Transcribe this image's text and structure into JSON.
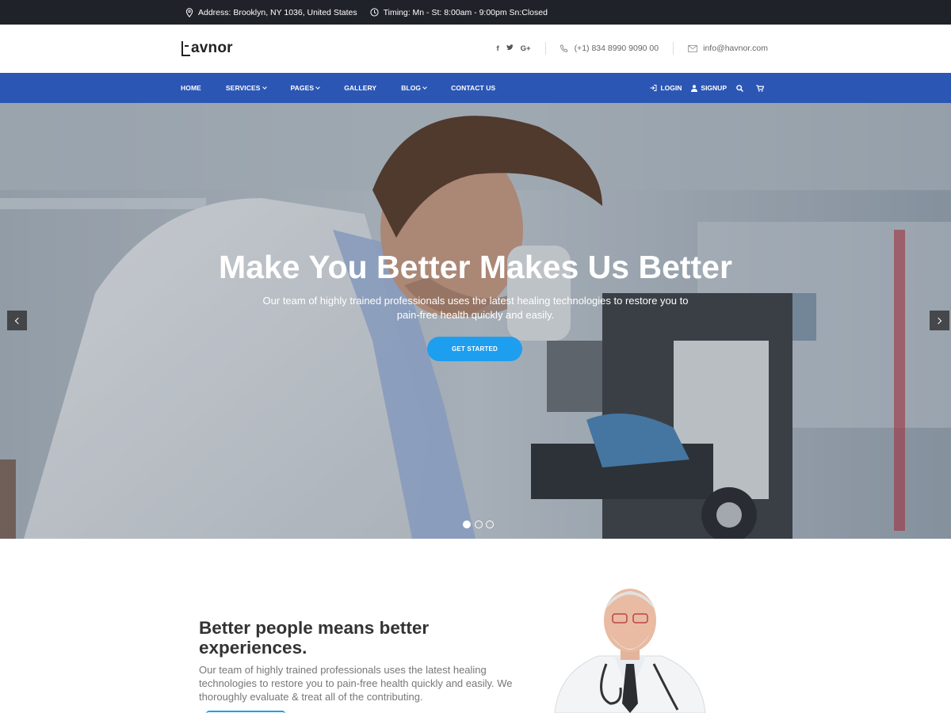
{
  "topbar": {
    "address": "Address: Brooklyn, NY 1036, United States",
    "timing": "Timing: Mn - St: 8:00am - 9:00pm Sn:Closed"
  },
  "header": {
    "logo_text": "avnor",
    "social": [
      "f",
      "y",
      "G+"
    ],
    "phone": "(+1) 834 8990 9090 00",
    "email": "info@havnor.com"
  },
  "nav": {
    "items": [
      {
        "label": "HOME",
        "dropdown": false
      },
      {
        "label": "SERVICES",
        "dropdown": true
      },
      {
        "label": "PAGES",
        "dropdown": true
      },
      {
        "label": "GALLERY",
        "dropdown": false
      },
      {
        "label": "BLOG",
        "dropdown": true
      },
      {
        "label": "CONTACT US",
        "dropdown": false
      }
    ],
    "login": "LOGIN",
    "signup": "SIGNUP"
  },
  "hero": {
    "title": "Make You Better Makes Us Better",
    "subtitle": "Our team of highly trained professionals uses the latest healing technologies to restore you to pain-free health quickly and easily.",
    "button": "GET STARTED",
    "slides": 3,
    "active_slide": 1
  },
  "intro": {
    "title": "Better people means better experiences.",
    "text": "Our team of highly trained professionals uses the latest healing technologies to restore you to pain-free health quickly and easily. We thoroughly evaluate & treat all of the contributing."
  },
  "colors": {
    "topbar": "#1f2229",
    "nav": "#2c56b4",
    "accent": "#1e9eef"
  }
}
